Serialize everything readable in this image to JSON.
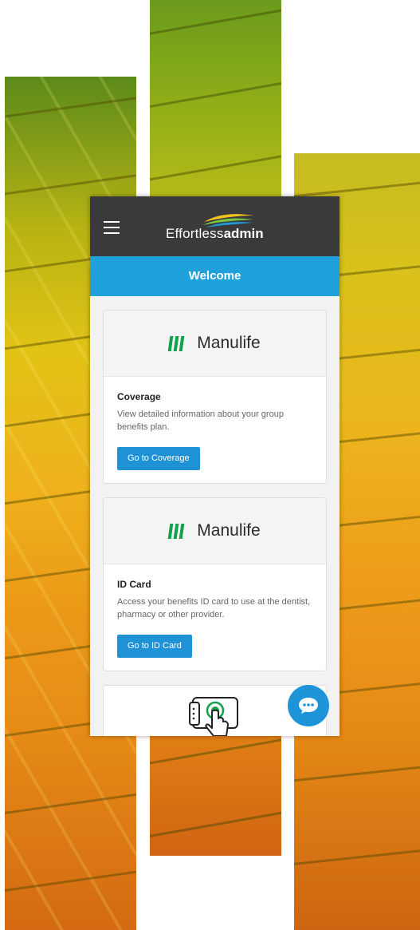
{
  "header": {
    "logo_light": "Effortless",
    "logo_bold": "admin"
  },
  "welcome": {
    "title": "Welcome"
  },
  "cards": [
    {
      "brand": "Manulife",
      "title": "Coverage",
      "description": "View detailed information about your group benefits plan.",
      "button": "Go to Coverage"
    },
    {
      "brand": "Manulife",
      "title": "ID Card",
      "description": "Access your benefits ID card to use at the dentist, pharmacy or other provider.",
      "button": "Go to ID Card"
    }
  ],
  "icons": {
    "menu": "hamburger-menu-icon",
    "chat": "chat-bubble-icon",
    "touch": "touch-screen-icon",
    "brand_mark": "manulife-mark-icon"
  },
  "colors": {
    "topbar": "#3a393c",
    "welcome_bar": "#1fa1dc",
    "button": "#1f92d6",
    "brand_green": "#10a14a"
  }
}
